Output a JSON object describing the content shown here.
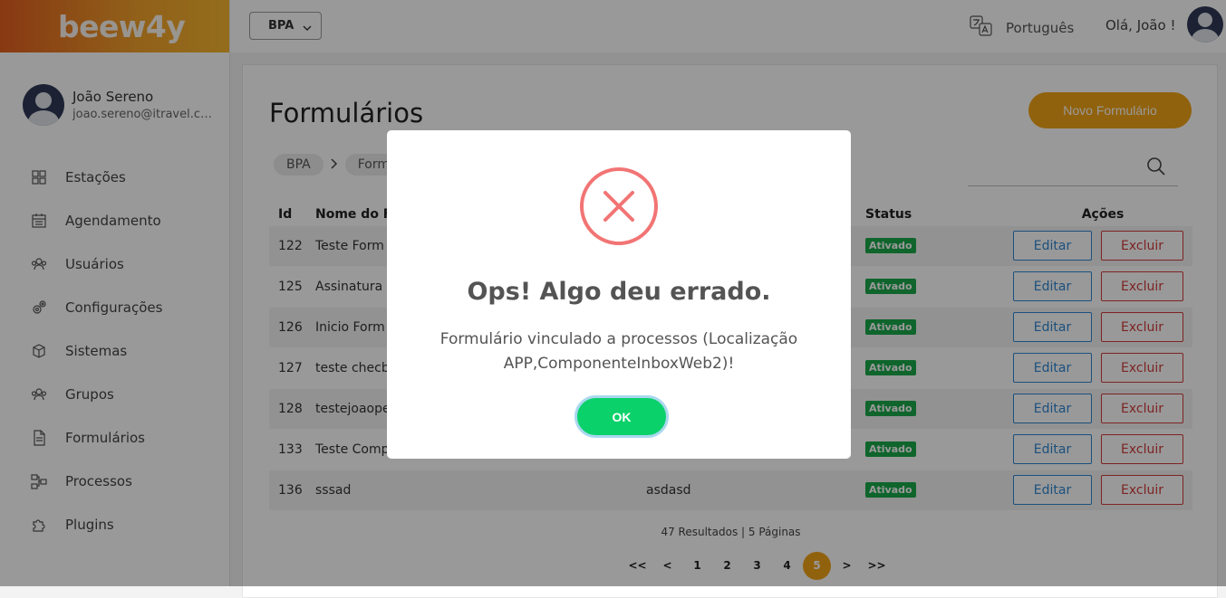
{
  "app": {
    "logo": "beew4y"
  },
  "user": {
    "name": "João Sereno",
    "email": "joao.sereno@itravel.co..."
  },
  "sidebar": {
    "items": [
      {
        "label": "Estações",
        "icon": "stations-icon"
      },
      {
        "label": "Agendamento",
        "icon": "calendar-icon"
      },
      {
        "label": "Usuários",
        "icon": "users-icon"
      },
      {
        "label": "Configurações",
        "icon": "gear-icon"
      },
      {
        "label": "Sistemas",
        "icon": "cube-icon"
      },
      {
        "label": "Grupos",
        "icon": "groups-icon"
      },
      {
        "label": "Formulários",
        "icon": "document-icon"
      },
      {
        "label": "Processos",
        "icon": "flow-icon"
      },
      {
        "label": "Plugins",
        "icon": "puzzle-icon"
      }
    ]
  },
  "topbar": {
    "company_select": "BPA",
    "language": "Português",
    "greeting": "Olá, João !"
  },
  "page": {
    "title": "Formulários",
    "new_button": "Novo Formulário",
    "breadcrumb": [
      "BPA",
      "Form"
    ]
  },
  "table": {
    "headers": {
      "id": "Id",
      "name": "Nome do Fo",
      "status": "Status",
      "actions": "Ações"
    },
    "rows": [
      {
        "id": "122",
        "name": "Teste Form",
        "desc": "",
        "status": "Ativado"
      },
      {
        "id": "125",
        "name": "Assinatura",
        "desc": "",
        "status": "Ativado"
      },
      {
        "id": "126",
        "name": "Inicio Form",
        "desc": "",
        "status": "Ativado"
      },
      {
        "id": "127",
        "name": "teste checb",
        "desc": "",
        "status": "Ativado"
      },
      {
        "id": "128",
        "name": "testejoaope",
        "desc": "",
        "status": "Ativado"
      },
      {
        "id": "133",
        "name": "Teste Comp",
        "desc": "",
        "status": "Ativado"
      },
      {
        "id": "136",
        "name": "sssad",
        "desc": "asdasd",
        "status": "Ativado"
      }
    ],
    "edit_label": "Editar",
    "delete_label": "Excluir"
  },
  "pagination": {
    "summary": "47 Resultados | 5 Páginas",
    "first": "<<",
    "prev": "<",
    "pages": [
      "1",
      "2",
      "3",
      "4",
      "5"
    ],
    "current": "5",
    "next": ">",
    "last": ">>"
  },
  "modal": {
    "title": "Ops! Algo deu errado.",
    "message": "Formulário vinculado a processos (Localização APP,ComponenteInboxWeb2)!",
    "ok": "OK"
  },
  "colors": {
    "accent": "#f2a316",
    "success": "#1aa84a",
    "edit": "#2f86d1",
    "delete": "#d23b3b",
    "ok_button": "#0bd16a",
    "error_icon": "#f27474"
  }
}
